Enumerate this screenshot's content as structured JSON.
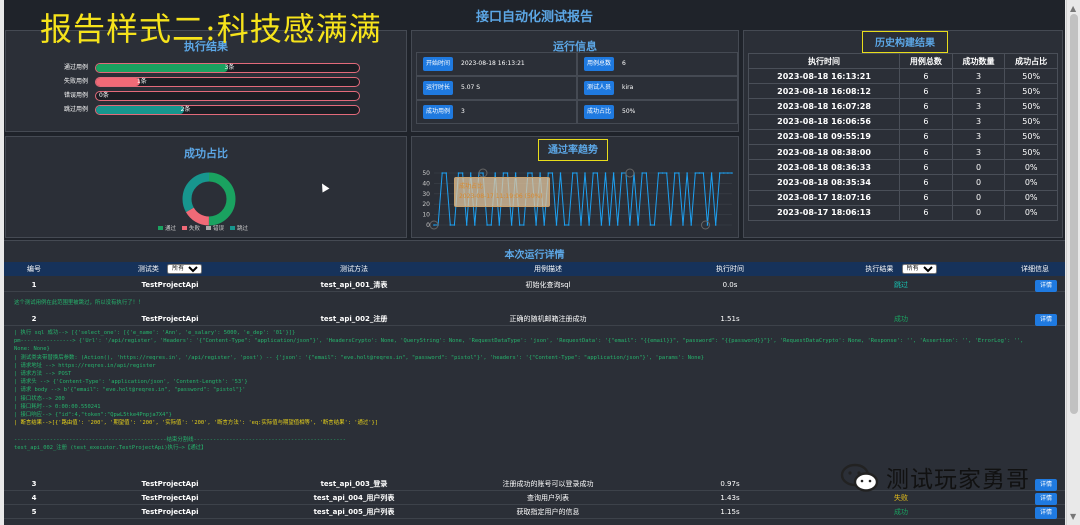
{
  "overlay_title": "报告样式二:科技感满满",
  "report_title": "接口自动化测试报告",
  "exec": {
    "title": "执行结果",
    "bars": [
      {
        "label": "通过用例",
        "value": "3条",
        "fill": 0.5,
        "color": "#1aa260"
      },
      {
        "label": "失败用例",
        "value": "1条",
        "fill": 0.167,
        "color": "#f06a77"
      },
      {
        "label": "错误用例",
        "value": "0条",
        "fill": 0,
        "color": "#aaaaaa"
      },
      {
        "label": "跳过用例",
        "value": "2条",
        "fill": 0.333,
        "color": "#17968e"
      }
    ]
  },
  "run_info": {
    "title": "运行信息",
    "items": [
      {
        "label": "开始时间",
        "value": "2023-08-18 16:13:21"
      },
      {
        "label": "用例总数",
        "value": "6"
      },
      {
        "label": "运行时长",
        "value": "5.07 S"
      },
      {
        "label": "测试人员",
        "value": "kira"
      },
      {
        "label": "成功用例",
        "value": "3"
      },
      {
        "label": "成功占比",
        "value": "50%"
      }
    ]
  },
  "history": {
    "title": "历史构建结果",
    "headers": [
      "执行时间",
      "用例总数",
      "成功数量",
      "成功占比"
    ],
    "rows": [
      [
        "2023-08-18 16:13:21",
        "6",
        "3",
        "50%"
      ],
      [
        "2023-08-18 16:08:12",
        "6",
        "3",
        "50%"
      ],
      [
        "2023-08-18 16:07:28",
        "6",
        "3",
        "50%"
      ],
      [
        "2023-08-18 16:06:56",
        "6",
        "3",
        "50%"
      ],
      [
        "2023-08-18 09:55:19",
        "6",
        "3",
        "50%"
      ],
      [
        "2023-08-18 08:38:00",
        "6",
        "3",
        "50%"
      ],
      [
        "2023-08-18 08:36:33",
        "6",
        "0",
        "0%"
      ],
      [
        "2023-08-18 08:35:34",
        "6",
        "0",
        "0%"
      ],
      [
        "2023-08-17 18:07:16",
        "6",
        "0",
        "0%"
      ],
      [
        "2023-08-17 18:06:13",
        "6",
        "0",
        "0%"
      ]
    ]
  },
  "ratio": {
    "title": "成功占比",
    "legend": [
      "通过",
      "失败",
      "错误",
      "跳过"
    ],
    "colors": [
      "#1aa260",
      "#f06a77",
      "#aaaaaa",
      "#17968e"
    ],
    "values": [
      3,
      1,
      0,
      2
    ]
  },
  "trend": {
    "title": "通过率趋势",
    "yticks": [
      "50",
      "40",
      "30",
      "20",
      "10",
      "0"
    ],
    "tooltip_title": "成功占比",
    "tooltip_value": "2023-08-17 11:19:06 (50%)"
  },
  "chart_data": {
    "type": "line",
    "title": "通过率趋势",
    "ylim": [
      0,
      50
    ],
    "y_ticks": [
      0,
      10,
      20,
      30,
      40,
      50
    ],
    "values": [
      0,
      0,
      50,
      50,
      0,
      0,
      50,
      50,
      0,
      50,
      0,
      50,
      50,
      0,
      0,
      50,
      0,
      50,
      50,
      0,
      50,
      0,
      0,
      50,
      50,
      0,
      50,
      0,
      50,
      50,
      0,
      50,
      0,
      0,
      50,
      50,
      0,
      50,
      0,
      50,
      50,
      0,
      50,
      0,
      50,
      0,
      50,
      50,
      0,
      50,
      0,
      50,
      50,
      0,
      0,
      50,
      50,
      50,
      0,
      50,
      50,
      0,
      50,
      0,
      50,
      50,
      50,
      0,
      50,
      0,
      50,
      50,
      50,
      50
    ]
  },
  "detail": {
    "title": "本次运行详情",
    "headers": {
      "no": "编号",
      "cls": "测试类",
      "method": "测试方法",
      "desc": "用例描述",
      "time": "执行时间",
      "result": "执行结果",
      "info": "详细信息"
    },
    "filter_all": "所有",
    "detail_btn": "详情",
    "rows": [
      {
        "no": "1",
        "cls": "TestProjectApi",
        "method": "test_api_001_清表",
        "desc": "初始化查询sql",
        "time": "0.0s",
        "result": "跳过",
        "rcolor": "#17c0b0"
      },
      {
        "no": "2",
        "cls": "TestProjectApi",
        "method": "test_api_002_注册",
        "desc": "正确的随机邮箱注册成功",
        "time": "1.51s",
        "result": "成功",
        "rcolor": "#1aa260"
      },
      {
        "no": "3",
        "cls": "TestProjectApi",
        "method": "test_api_003_登录",
        "desc": "注册成功的账号可以登录成功",
        "time": "0.97s",
        "result": "",
        "rcolor": "#1aa260"
      },
      {
        "no": "4",
        "cls": "TestProjectApi",
        "method": "test_api_004_用户列表",
        "desc": "查询用户列表",
        "time": "1.43s",
        "result": "失败",
        "rcolor": "#e8c01a"
      },
      {
        "no": "5",
        "cls": "TestProjectApi",
        "method": "test_api_005_用户列表",
        "desc": "获取指定用户的信息",
        "time": "1.15s",
        "result": "成功",
        "rcolor": "#1aa260"
      }
    ],
    "skip_msg": "这个测试用例在此范围里被跳过，所以没有执行了！！",
    "log_lines": [
      "| 执行 sql 成功--> [{'select_one': [{'e_name': 'Ann', 'e_salary': 5000, 'e_dep': '01'}]}",
      "pm----------------> {'Url': '/api/register', 'Headers': '{\"Content-Type\": \"application/json\"}', 'HeadersCrypto': None, 'QueryString': None, 'RequestDataType': 'json', 'RequestData': '{\"email\": \"{{email}}\", \"password\": \"{{password}}\"}', 'RequestDataCrypto': None, 'Response': '', 'Assertion': '', 'ErrorLog': '',",
      "None: None}",
      "| 测试类夹带替换后参数: (Action(), 'https://reqres.in', '/api/register', 'post') -- {'json': '{\"email\": \"eve.holt@reqres.in\", \"password\": \"pistol\"}', 'headers': '{\"Content-Type\": \"application/json\"}', 'params': None}",
      "| 请求地址 --> https://reqres.in/api/register",
      "| 请求方法 --> POST",
      "| 请求头 --> {'Content-Type': 'application/json', 'Content-Length': '53'}",
      "| 请求 body --> b'{\"email\": \"eve.holt@reqres.in\", \"password\": \"pistol\"}'",
      "| 接口状态--> 200",
      "| 接口耗时--> 0:00:00.550241",
      "| 接口响应--> {\"id\":4,\"token\":\"QpwL5tke4Pnpja7X4\"}",
      "| 断言结果-->[{'路由值': '200', '期望值': '200', '实际值': '200', '断言方法': 'eq:实际值与期望值相等', '断言结果': '通过'}]",
      "",
      "-----------------------------------------------结束分割线-----------------------------------------------",
      "test_api_002_注册 (test_executor.TestProjectApi)执行—>【通过】"
    ]
  },
  "watermark": "测试玩家勇哥"
}
